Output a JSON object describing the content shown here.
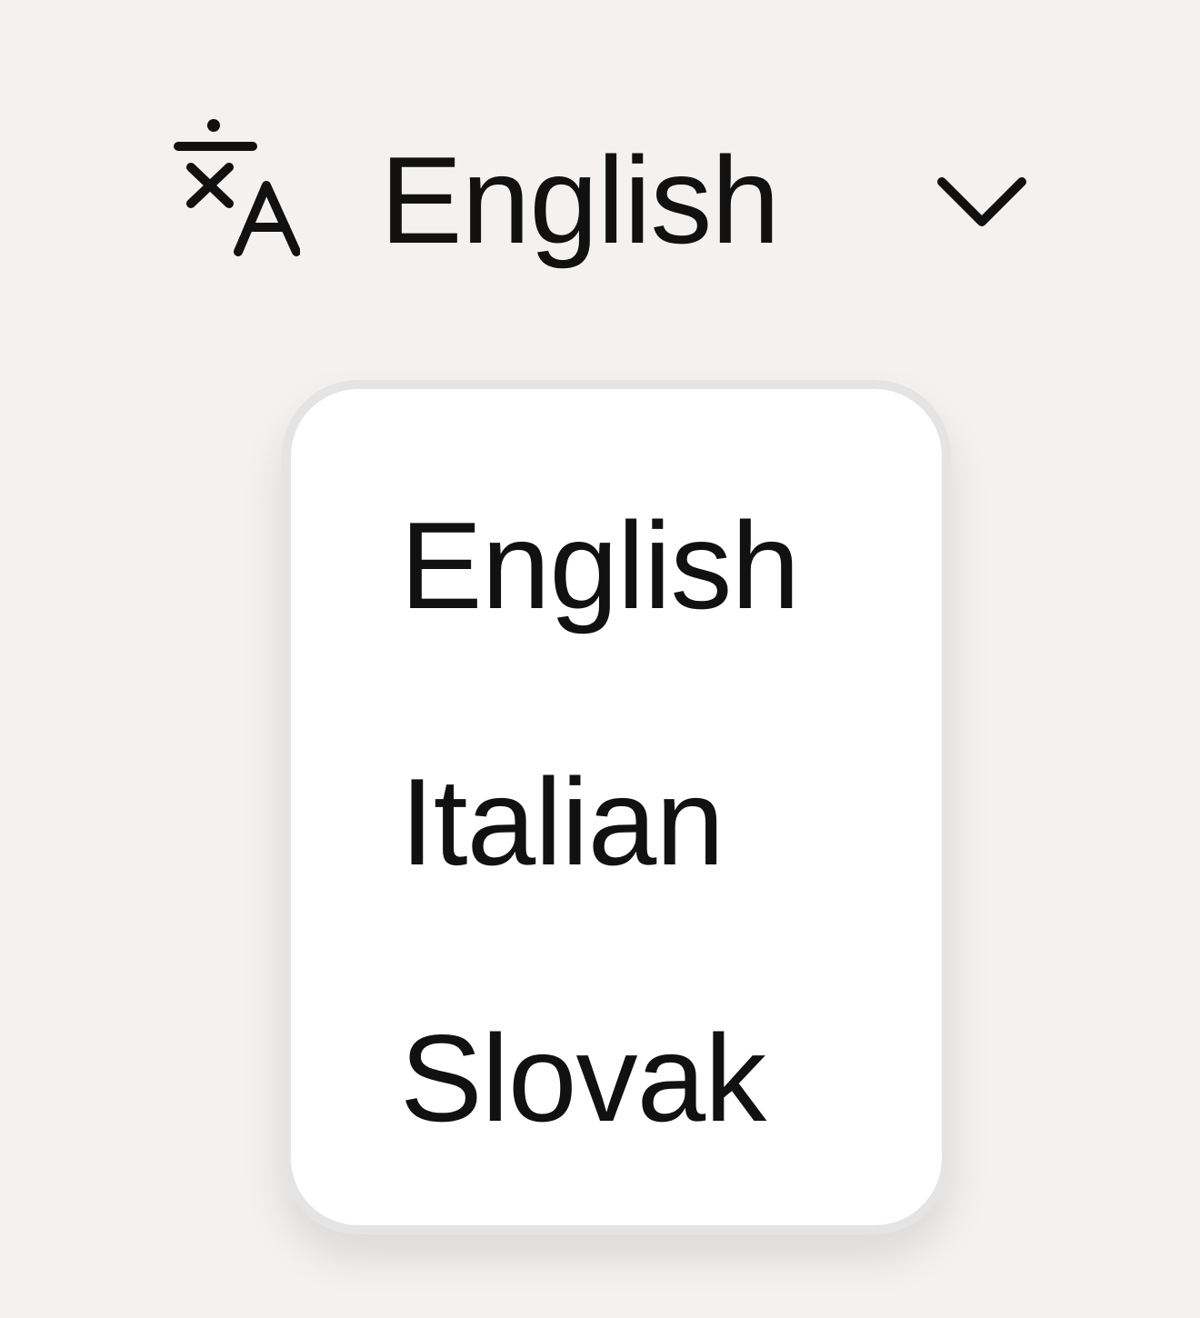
{
  "language_selector": {
    "icon": "translate-icon",
    "selected_label": "English",
    "chevron_icon": "chevron-down-icon",
    "menu": {
      "options": [
        {
          "label": "English"
        },
        {
          "label": "Italian"
        },
        {
          "label": "Slovak"
        }
      ]
    }
  },
  "colors": {
    "background": "#f4f2f0",
    "menu_background": "#ffffff",
    "menu_border": "#e4e4e4",
    "text": "#111111"
  }
}
